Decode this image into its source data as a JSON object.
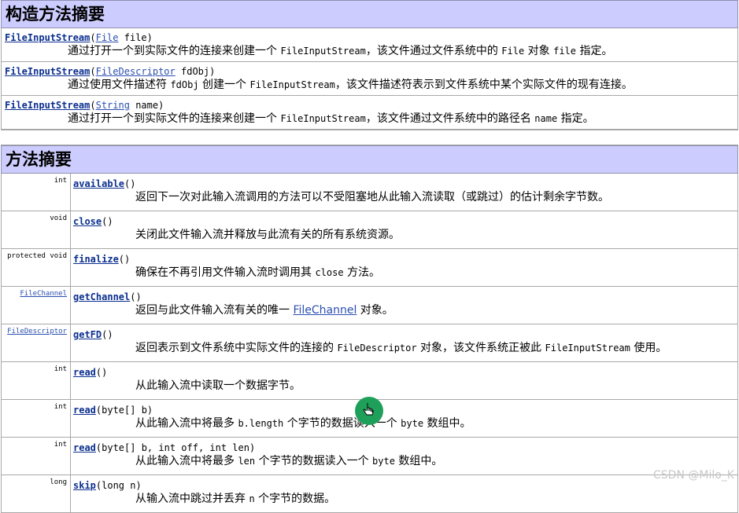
{
  "ctor_section": {
    "title": "构造方法摘要"
  },
  "constructors": [
    {
      "name": "FileInputStream",
      "open": "(",
      "param_type": "File",
      "param_rest": " file)",
      "desc": [
        {
          "t": "通过打开一个到实际文件的连接来创建一个 "
        },
        {
          "t": "FileInputStream",
          "c": true
        },
        {
          "t": "，该文件通过文件系统中的 "
        },
        {
          "t": "File",
          "c": true
        },
        {
          "t": " 对象 "
        },
        {
          "t": "file",
          "c": true
        },
        {
          "t": " 指定。"
        }
      ]
    },
    {
      "name": "FileInputStream",
      "open": "(",
      "param_type": "FileDescriptor",
      "param_rest": " fdObj)",
      "desc": [
        {
          "t": "通过使用文件描述符 "
        },
        {
          "t": "fdObj",
          "c": true
        },
        {
          "t": " 创建一个 "
        },
        {
          "t": "FileInputStream",
          "c": true
        },
        {
          "t": "，该文件描述符表示到文件系统中某个实际文件的现有连接。"
        }
      ]
    },
    {
      "name": "FileInputStream",
      "open": "(",
      "param_type": "String",
      "param_rest": " name)",
      "desc": [
        {
          "t": "通过打开一个到实际文件的连接来创建一个 "
        },
        {
          "t": "FileInputStream",
          "c": true
        },
        {
          "t": "，该文件通过文件系统中的路径名 "
        },
        {
          "t": "name",
          "c": true
        },
        {
          "t": " 指定。"
        }
      ]
    }
  ],
  "method_section": {
    "title": "方法摘要"
  },
  "methods": [
    {
      "ret": "int",
      "name": "available",
      "params": "()",
      "desc": [
        {
          "t": "返回下一次对此输入流调用的方法可以不受阻塞地从此输入流读取（或跳过）的估计剩余字节数。"
        }
      ]
    },
    {
      "ret": "void",
      "name": "close",
      "params": "()",
      "desc": [
        {
          "t": "关闭此文件输入流并释放与此流有关的所有系统资源。"
        }
      ]
    },
    {
      "ret": "protected  void",
      "name": "finalize",
      "params": "()",
      "desc": [
        {
          "t": "确保在不再引用文件输入流时调用其 "
        },
        {
          "t": "close",
          "c": true
        },
        {
          "t": " 方法。"
        }
      ]
    },
    {
      "ret": "FileChannel",
      "ret_link": true,
      "name": "getChannel",
      "params": "()",
      "desc": [
        {
          "t": "返回与此文件输入流有关的唯一 "
        },
        {
          "t": "FileChannel",
          "l": true
        },
        {
          "t": " 对象。"
        }
      ]
    },
    {
      "ret": "FileDescriptor",
      "ret_link": true,
      "name": "getFD",
      "params": "()",
      "desc": [
        {
          "t": "返回表示到文件系统中实际文件的连接的 "
        },
        {
          "t": "FileDescriptor",
          "c": true
        },
        {
          "t": " 对象，该文件系统正被此 "
        },
        {
          "t": "FileInputStream",
          "c": true
        },
        {
          "t": " 使用。"
        }
      ]
    },
    {
      "ret": "int",
      "name": "read",
      "params": "()",
      "desc": [
        {
          "t": "从此输入流中读取一个数据字节。"
        }
      ]
    },
    {
      "ret": "int",
      "name": "read",
      "params": "(byte[] b)",
      "desc": [
        {
          "t": "从此输入流中将最多 "
        },
        {
          "t": "b.length",
          "c": true
        },
        {
          "t": " 个字节的数据读入一个 "
        },
        {
          "t": "byte",
          "c": true
        },
        {
          "t": " 数组中。"
        }
      ]
    },
    {
      "ret": "int",
      "name": "read",
      "params": "(byte[] b, int off, int len)",
      "desc": [
        {
          "t": "从此输入流中将最多 "
        },
        {
          "t": "len",
          "c": true
        },
        {
          "t": " 个字节的数据读入一个 "
        },
        {
          "t": "byte",
          "c": true
        },
        {
          "t": " 数组中。"
        }
      ]
    },
    {
      "ret": "long",
      "name": "skip",
      "params": "(long n)",
      "desc": [
        {
          "t": "从输入流中跳过并丢弃 "
        },
        {
          "t": "n",
          "c": true
        },
        {
          "t": " 个字节的数据。"
        }
      ]
    }
  ],
  "watermark": "CSDN @Milo_K",
  "colors": {
    "header_bg": "#ccccff",
    "link": "#0b2f8f",
    "cursor": "#1fa05a"
  }
}
